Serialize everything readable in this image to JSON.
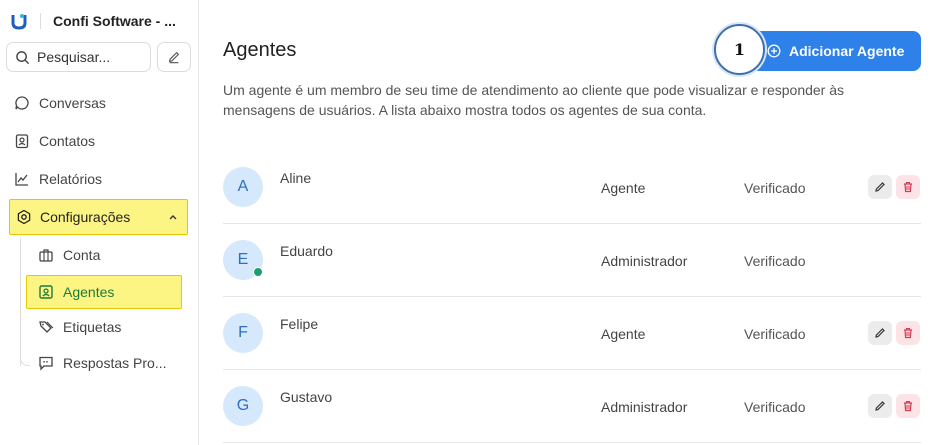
{
  "sidebar": {
    "brand_name": "Confi Software - ...",
    "search_placeholder": "Pesquisar...",
    "items": [
      {
        "label": "Conversas",
        "icon": "chat-bubble-icon"
      },
      {
        "label": "Contatos",
        "icon": "contact-card-icon"
      },
      {
        "label": "Relatórios",
        "icon": "line-chart-icon"
      },
      {
        "label": "Configurações",
        "icon": "settings-hexagon-icon"
      }
    ],
    "sub_items": [
      {
        "label": "Conta",
        "icon": "briefcase-icon"
      },
      {
        "label": "Agentes",
        "icon": "agent-badge-icon"
      },
      {
        "label": "Etiquetas",
        "icon": "tags-icon"
      },
      {
        "label": "Respostas Pro...",
        "icon": "canned-reply-icon"
      }
    ]
  },
  "main": {
    "title": "Agentes",
    "add_button_label": "Adicionar Agente",
    "step_badge": "1",
    "description": "Um agente é um membro de seu time de atendimento ao cliente que pode visualizar e responder às mensagens de usuários. A lista abaixo mostra todos os agentes de sua conta.",
    "agents": [
      {
        "initial": "A",
        "name": "Aline",
        "role": "Agente",
        "status": "Verificado",
        "online": false,
        "actions": true
      },
      {
        "initial": "E",
        "name": "Eduardo",
        "role": "Administrador",
        "status": "Verificado",
        "online": true,
        "actions": false
      },
      {
        "initial": "F",
        "name": "Felipe",
        "role": "Agente",
        "status": "Verificado",
        "online": false,
        "actions": true
      },
      {
        "initial": "G",
        "name": "Gustavo",
        "role": "Administrador",
        "status": "Verificado",
        "online": false,
        "actions": true
      }
    ]
  },
  "colors": {
    "accent": "#2d81e8",
    "highlight": "#fdf583",
    "online": "#1a9e6a"
  }
}
